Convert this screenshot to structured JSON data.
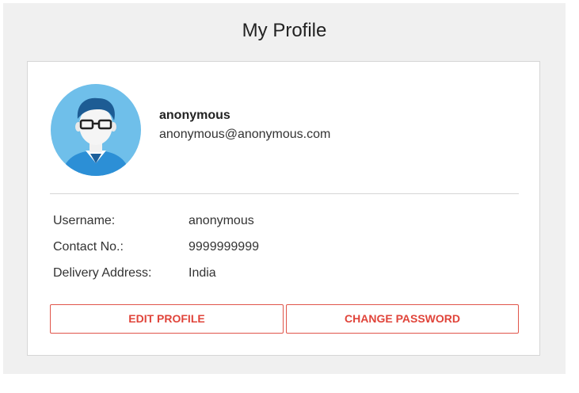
{
  "page": {
    "title": "My Profile"
  },
  "profile": {
    "avatar_icon": "user-avatar-icon",
    "name": "anonymous",
    "email": "anonymous@anonymous.com"
  },
  "details": [
    {
      "label": "Username:",
      "value": "anonymous"
    },
    {
      "label": "Contact No.:",
      "value": "9999999999"
    },
    {
      "label": "Delivery Address:",
      "value": "India"
    }
  ],
  "actions": {
    "edit_label": "EDIT PROFILE",
    "change_password_label": "CHANGE PASSWORD"
  },
  "colors": {
    "accent": "#e0443a",
    "avatar_bg": "#6fbfea",
    "page_bg": "#f0f0f0"
  }
}
